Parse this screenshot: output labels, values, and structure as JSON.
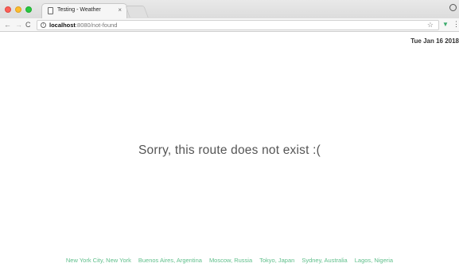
{
  "browser": {
    "tab_title": "Testing - Weather",
    "tab_close": "×",
    "url_host": "localhost",
    "url_rest": ":8080/not-found",
    "icons": {
      "back": "arrow-left-icon",
      "forward": "arrow-right-icon",
      "reload": "reload-icon",
      "star": "star-icon",
      "extension": "vue-devtools-icon",
      "menu": "kebab-menu-icon"
    }
  },
  "page": {
    "date": "Tue Jan 16 2018",
    "message": "Sorry, this route does not exist :(",
    "cities": [
      "New York City, New York",
      "Buenos Aires, Argentina",
      "Moscow, Russia",
      "Tokyo, Japan",
      "Sydney, Australia",
      "Lagos, Nigeria"
    ]
  },
  "colors": {
    "link": "#5fbf8b",
    "message": "#555555"
  }
}
